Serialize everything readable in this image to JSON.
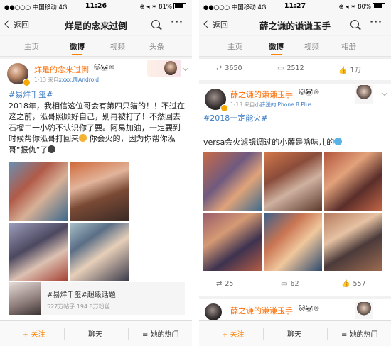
{
  "screens": [
    {
      "status": {
        "carrier": "●●○○○ 中国移动  4G",
        "time": "11:26",
        "battery": "⊕ ◂ ✶ 81%",
        "battery_level": 0.81
      },
      "nav": {
        "back": "返回",
        "title": "烊是的念来过倒"
      },
      "tabs": [
        "主页",
        "微博",
        "视频",
        "头条"
      ],
      "active_tab": 1,
      "post": {
        "username": "烊是的念来过倒",
        "badges": "🐱🐼®",
        "time": "1-13",
        "source_prefix": "来自",
        "source": "xxxx.面Android",
        "hashtag": "#易烊千玺#",
        "text": "2018年，我相信这位哥会有第四只猫的！！不过在这之前，泓哥照顾好自己，别再被打了！不然回去石榴二十小豹不认识你了要。阿易加油，一定要到时候帮你泓哥打回来",
        "text_2": " 你会火的，因为你帮你泓哥“报仇”了",
        "topic": {
          "title": "#易烊千玺#超级话题",
          "stats": "527万帖子 194.8万粉丝"
        }
      },
      "bottom": {
        "follow": "+ 关注",
        "chat": "聊天",
        "hot": "她的热门"
      }
    },
    {
      "status": {
        "carrier": "●●○○○ 中国移动  4G",
        "time": "11:27",
        "battery": "⊕ ◂ ✶ 80%",
        "battery_level": 0.8
      },
      "nav": {
        "back": "返回",
        "title": "薛之谦的谦谦玉手"
      },
      "tabs": [
        "主页",
        "微博",
        "视频",
        "相册"
      ],
      "active_tab": 1,
      "prev_actions": {
        "repost": "3650",
        "comment": "2512",
        "like": "1万"
      },
      "post": {
        "username": "薛之谦的谦谦玉手",
        "badges": "🐱🐼®",
        "time": "1-13",
        "source_prefix": "来自",
        "source": "小薛送的iPhone 8 Plus",
        "hashtag": "#2018一定能火#",
        "text": "versa会火滤镜调过的小薛是啥味儿的"
      },
      "actions": {
        "repost": "25",
        "comment": "62",
        "like": "557"
      },
      "next_post": {
        "username": "薛之谦的谦谦玉手",
        "badges": "🐱🐼®"
      },
      "bottom": {
        "follow": "+ 关注",
        "chat": "聊天",
        "hot": "她的热门"
      }
    }
  ],
  "colors": {
    "accent": "#ff8200",
    "username": "#ff6a00",
    "link": "#3c7bc4"
  },
  "icons": {
    "repost": "repost-icon",
    "comment": "comment-icon",
    "like": "like-icon"
  }
}
